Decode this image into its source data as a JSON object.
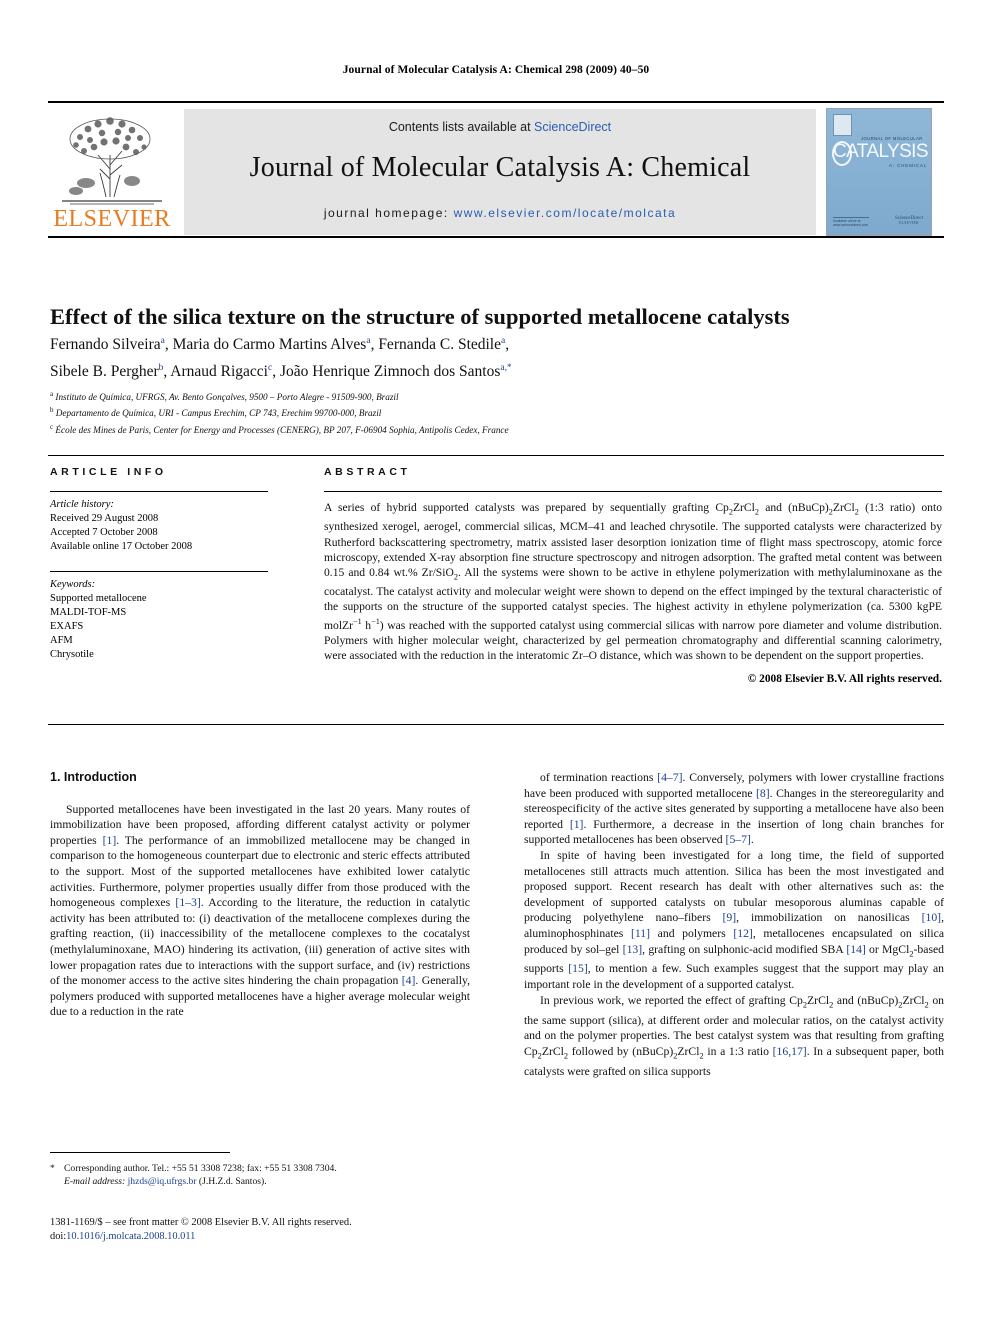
{
  "running_head": "Journal of Molecular Catalysis A: Chemical 298 (2009) 40–50",
  "masthead": {
    "publisher": "ELSEVIER",
    "contents_prefix": "Contents lists available at ",
    "contents_link": "ScienceDirect",
    "journal_name": "Journal of Molecular Catalysis A: Chemical",
    "homepage_label": "journal homepage:",
    "homepage_url": "www.elsevier.com/locate/molcata",
    "cover": {
      "kicker": "JOURNAL OF MOLECULAR",
      "title": "CATALYSIS",
      "subtitle": "A: CHEMICAL",
      "footer_left": "Available online at www.sciencedirect.com",
      "footer_right_top": "ScienceDirect",
      "footer_right_bottom": "ELSEVIER"
    }
  },
  "article": {
    "title": "Effect of the silica texture on the structure of supported metallocene catalysts",
    "authors_line_1": "Fernando Silveira",
    "authors_line_1_b": ", Maria do Carmo Martins Alves",
    "authors_line_1_c": ", Fernanda C. Stedile",
    "authors_line_2_a": "Sibele B. Pergher",
    "authors_line_2_b": ", Arnaud Rigacci",
    "authors_line_2_c": ", João Henrique Zimnoch dos Santos",
    "affiliations": [
      {
        "mark": "a",
        "text": "Instituto de Química, UFRGS, Av. Bento Gonçalves, 9500 – Porto Alegre - 91509-900, Brazil"
      },
      {
        "mark": "b",
        "text": "Departamento de Química, URI - Campus Erechim, CP 743, Erechim 99700-000, Brazil"
      },
      {
        "mark": "c",
        "text": "École des Mines de Paris, Center for Energy and Processes (CENERG), BP 207, F-06904 Sophia, Antipolis Cedex, France"
      }
    ]
  },
  "article_info": {
    "heading": "ARTICLE INFO",
    "history_label": "Article history:",
    "history": [
      "Received 29 August 2008",
      "Accepted 7 October 2008",
      "Available online 17 October 2008"
    ],
    "keywords_label": "Keywords:",
    "keywords": [
      "Supported metallocene",
      "MALDI-TOF-MS",
      "EXAFS",
      "AFM",
      "Chrysotile"
    ]
  },
  "abstract": {
    "heading": "ABSTRACT",
    "part1": "A series of hybrid supported catalysts was prepared by sequentially grafting Cp",
    "sub1": "2",
    "part2": "ZrCl",
    "sub2": "2",
    "part3": " and (nBuCp)",
    "sub3": "2",
    "part4": "ZrCl",
    "sub4": "2",
    "part5": " (1:3 ratio) onto synthesized xerogel, aerogel, commercial silicas, MCM–41 and leached chrysotile. The supported catalysts were characterized by Rutherford backscattering spectrometry, matrix assisted laser desorption ionization time of flight mass spectroscopy, atomic force microscopy, extended X-ray absorption fine structure spectroscopy and nitrogen adsorption. The grafted metal content was between 0.15 and 0.84 wt.% Zr/SiO",
    "sub5": "2",
    "part6": ". All the systems were shown to be active in ethylene polymerization with methylaluminoxane as the cocatalyst. The catalyst activity and molecular weight were shown to depend on the effect impinged by the textural characteristic of the supports on the structure of the supported catalyst species. The highest activity in ethylene polymerization (ca. 5300 kgPE molZr",
    "sup1": "−1",
    "part7": " h",
    "sup2": "−1",
    "part8": ") was reached with the supported catalyst using commercial silicas with narrow pore diameter and volume distribution. Polymers with higher molecular weight, characterized by gel permeation chromatography and differential scanning calorimetry, were associated with the reduction in the interatomic Zr–O distance, which was shown to be dependent on the support properties.",
    "copyright": "© 2008 Elsevier B.V. All rights reserved."
  },
  "body": {
    "section_title": "1. Introduction",
    "left_p1_a": "Supported metallocenes have been investigated in the last 20 years. Many routes of immobilization have been proposed, affording different catalyst activity or polymer properties ",
    "left_p1_ref1": "[1]",
    "left_p1_b": ". The performance of an immobilized metallocene may be changed in comparison to the homogeneous counterpart due to electronic and steric effects attributed to the support. Most of the supported metallocenes have exhibited lower catalytic activities. Furthermore, polymer properties usually differ from those produced with the homogeneous complexes ",
    "left_p1_ref2": "[1–3]",
    "left_p1_c": ". According to the literature, the reduction in catalytic activity has been attributed to: (i) deactivation of the metallocene complexes during the grafting reaction, (ii) inaccessibility of the metallocene complexes to the cocatalyst (methylaluminoxane, MAO) hindering its activation, (iii) generation of active sites with lower propagation rates due to interactions with the support surface, and (iv) restrictions of the monomer access to the active sites hindering the chain propagation ",
    "left_p1_ref3": "[4]",
    "left_p1_d": ". Generally, polymers produced with supported metallocenes have a higher average molecular weight due to a reduction in the rate",
    "right_p1_a": "of termination reactions ",
    "right_p1_ref1": "[4–7]",
    "right_p1_b": ". Conversely, polymers with lower crystalline fractions have been produced with supported metallocene ",
    "right_p1_ref2": "[8]",
    "right_p1_c": ". Changes in the stereoregularity and stereospecificity of the active sites generated by supporting a metallocene have also been reported ",
    "right_p1_ref3": "[1]",
    "right_p1_d": ". Furthermore, a decrease in the insertion of long chain branches for supported metallocenes has been observed ",
    "right_p1_ref4": "[5–7]",
    "right_p1_e": ".",
    "right_p2_a": "In spite of having been investigated for a long time, the field of supported metallocenes still attracts much attention. Silica has been the most investigated and proposed support. Recent research has dealt with other alternatives such as: the development of supported catalysts on tubular mesoporous aluminas capable of producing polyethylene nano–fibers ",
    "right_p2_ref1": "[9]",
    "right_p2_b": ", immobilization on nanosilicas ",
    "right_p2_ref2": "[10]",
    "right_p2_c": ", aluminophosphinates ",
    "right_p2_ref3": "[11]",
    "right_p2_d": " and polymers ",
    "right_p2_ref4": "[12]",
    "right_p2_e": ", metallocenes encapsulated on silica produced by sol–gel ",
    "right_p2_ref5": "[13]",
    "right_p2_f": ", grafting on sulphonic-acid modified SBA ",
    "right_p2_ref6": "[14]",
    "right_p2_g": " or MgCl",
    "right_p2_sub": "2",
    "right_p2_h": "-based supports ",
    "right_p2_ref7": "[15]",
    "right_p2_i": ", to mention a few. Such examples suggest that the support may play an important role in the development of a supported catalyst.",
    "right_p3_a": "In previous work, we reported the effect of grafting Cp",
    "right_p3_sub1": "2",
    "right_p3_b": "ZrCl",
    "right_p3_sub2": "2",
    "right_p3_c": " and (nBuCp)",
    "right_p3_sub3": "2",
    "right_p3_d": "ZrCl",
    "right_p3_sub4": "2",
    "right_p3_e": " on the same support (silica), at different order and molecular ratios, on the catalyst activity and on the polymer properties. The best catalyst system was that resulting from grafting Cp",
    "right_p3_sub5": "2",
    "right_p3_f": "ZrCl",
    "right_p3_sub6": "2",
    "right_p3_g": " followed by (nBuCp)",
    "right_p3_sub7": "2",
    "right_p3_h": "ZrCl",
    "right_p3_sub8": "2",
    "right_p3_i": " in a 1:3 ratio ",
    "right_p3_ref1": "[16,17]",
    "right_p3_j": ". In a subsequent paper, both catalysts were grafted on silica supports"
  },
  "footnotes": {
    "star": "*",
    "corresponding": "Corresponding author. Tel.: +55 51 3308 7238; fax: +55 51 3308 7304.",
    "email_label": "E-mail address:",
    "email": "jhzds@iq.ufrgs.br",
    "email_owner": "(J.H.Z.d. Santos).",
    "issn_line": "1381-1169/$ – see front matter © 2008 Elsevier B.V. All rights reserved.",
    "doi_label": "doi:",
    "doi": "10.1016/j.molcata.2008.10.011"
  },
  "colors": {
    "elsevier_orange": "#E87B22",
    "link_blue": "#2a5db0",
    "ref_blue": "#1d3f8f",
    "masthead_gray": "#e4e4e4",
    "cover_blue": "#8ab3d4"
  }
}
